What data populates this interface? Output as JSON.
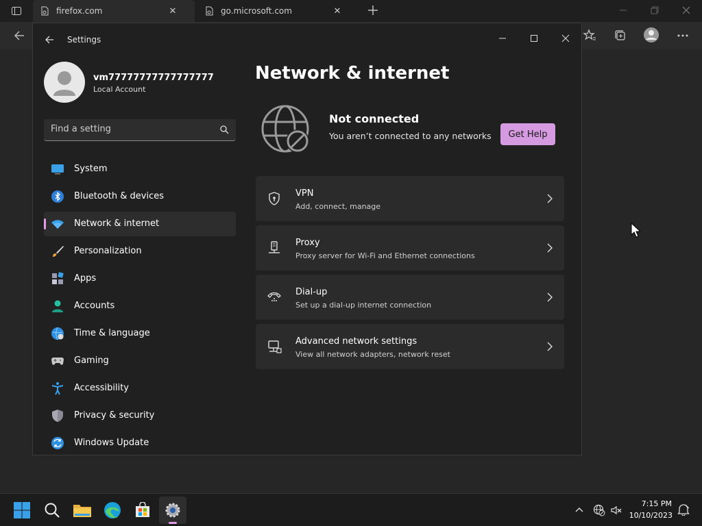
{
  "browser": {
    "tabs": [
      {
        "title": "firefox.com",
        "active": true
      },
      {
        "title": "go.microsoft.com",
        "active": false
      }
    ]
  },
  "settings": {
    "window_title": "Settings",
    "user": {
      "name": "vm77777777777777777",
      "account_type": "Local Account"
    },
    "search": {
      "placeholder": "Find a setting"
    },
    "nav": [
      {
        "label": "System",
        "icon": "monitor-icon"
      },
      {
        "label": "Bluetooth & devices",
        "icon": "bluetooth-icon"
      },
      {
        "label": "Network & internet",
        "icon": "wifi-icon",
        "selected": true
      },
      {
        "label": "Personalization",
        "icon": "brush-icon"
      },
      {
        "label": "Apps",
        "icon": "apps-icon"
      },
      {
        "label": "Accounts",
        "icon": "person-icon"
      },
      {
        "label": "Time & language",
        "icon": "globe-clock-icon"
      },
      {
        "label": "Gaming",
        "icon": "gamepad-icon"
      },
      {
        "label": "Accessibility",
        "icon": "accessibility-icon"
      },
      {
        "label": "Privacy & security",
        "icon": "shield-icon"
      },
      {
        "label": "Windows Update",
        "icon": "update-icon"
      }
    ],
    "page_title": "Network & internet",
    "status": {
      "title": "Not connected",
      "description": "You aren’t connected to any networks",
      "help_button": "Get Help"
    },
    "cards": [
      {
        "title": "VPN",
        "subtitle": "Add, connect, manage",
        "icon": "vpn-shield-icon"
      },
      {
        "title": "Proxy",
        "subtitle": "Proxy server for Wi-Fi and Ethernet connections",
        "icon": "proxy-icon"
      },
      {
        "title": "Dial-up",
        "subtitle": "Set up a dial-up internet connection",
        "icon": "dialup-icon"
      },
      {
        "title": "Advanced network settings",
        "subtitle": "View all network adapters, network reset",
        "icon": "advanced-network-icon"
      }
    ]
  },
  "taskbar": {
    "time": "7:15 PM",
    "date": "10/10/2023"
  },
  "colors": {
    "accent": "#d69ae0",
    "selection_bar": "#e49ce8"
  }
}
